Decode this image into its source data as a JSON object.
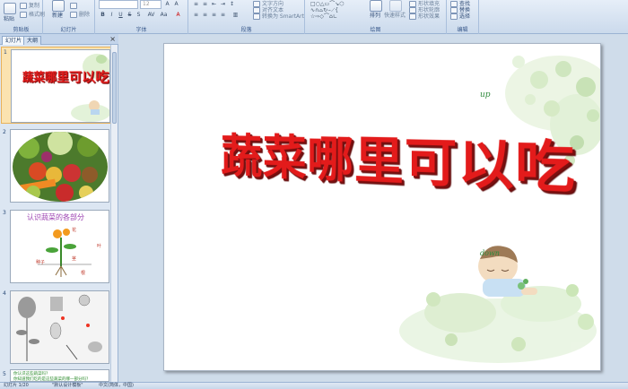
{
  "ribbon": {
    "clipboard": {
      "paste": "粘贴",
      "copy": "复制",
      "format_painter": "格式刷",
      "title": "剪贴板"
    },
    "slides": {
      "new_slide": "新建",
      "layout_label": "幻灯片",
      "delete": "删除",
      "title": "幻灯片"
    },
    "font": {
      "font_size": "12",
      "title": "字体"
    },
    "paragraph": {
      "text_direction": "文字方向",
      "align_text": "对齐文本",
      "smartart": "转换为 SmartArt",
      "title": "段落"
    },
    "drawing": {
      "arrange": "排列",
      "quick_styles": "快速样式",
      "shape_fill": "形状填充",
      "shape_outline": "形状轮廓",
      "shape_effects": "形状效果",
      "title": "绘图"
    },
    "editing": {
      "find": "查找",
      "replace": "替换",
      "select": "选择",
      "title": "编辑"
    }
  },
  "left_panel": {
    "tabs": [
      "幻灯片",
      "大纲"
    ],
    "close": "×",
    "slides": [
      {
        "number": "1",
        "title": "蔬菜哪里可以吃"
      },
      {
        "number": "2"
      },
      {
        "number": "3",
        "title": "认识蔬菜的各部分",
        "labels": {
          "flower": "花",
          "leaf": "叶",
          "seed": "种子",
          "stem": "茎",
          "root": "根"
        }
      },
      {
        "number": "4"
      },
      {
        "number": "5",
        "line1": "你认识这些蔬菜吗?",
        "line2": "你知道我们吃的是这些蔬菜的哪一部分吗?"
      }
    ]
  },
  "slide": {
    "title": "蔬菜哪里可以吃",
    "up": "up",
    "down": "down"
  },
  "status": {
    "slide_info": "幻灯片 1/20",
    "theme": "\"默认设计模板\"",
    "language": "中文(简体，中国)"
  },
  "colors": {
    "title_red": "#e31b1b",
    "accent_green": "#2f8a3c",
    "ribbon_blue": "#cbdaec"
  }
}
